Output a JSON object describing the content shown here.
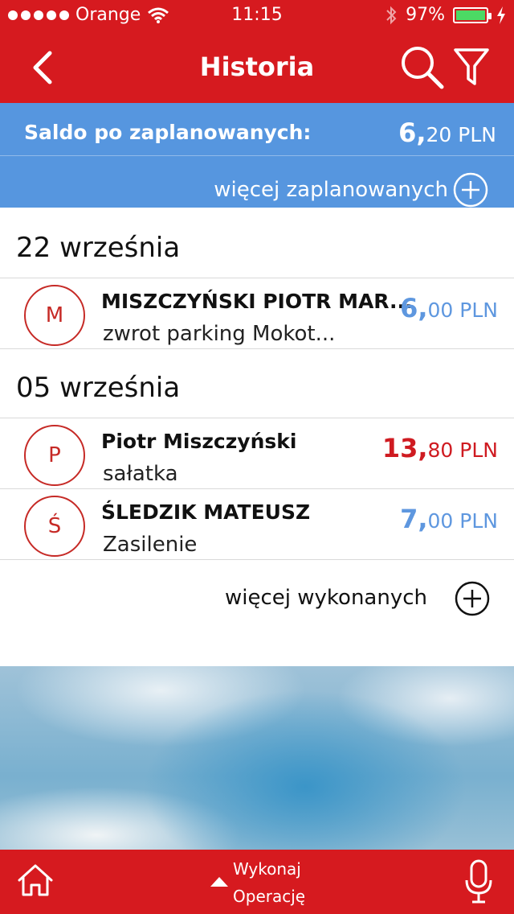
{
  "status_bar": {
    "carrier": "Orange",
    "time": "11:15",
    "battery_percent": "97%",
    "battery_level": 0.97,
    "icons": [
      "signal-dots",
      "wifi-icon",
      "bluetooth-icon",
      "battery-icon",
      "charging-icon"
    ]
  },
  "nav": {
    "title": "Historia",
    "icons": [
      "back-chevron-icon",
      "search-icon",
      "filter-icon"
    ]
  },
  "saldo": {
    "label": "Saldo po zaplanowanych:",
    "amount_int": "6,",
    "amount_dec": "20 PLN",
    "more_planned": "więcej zaplanowanych"
  },
  "groups": [
    {
      "date": "22 września",
      "transactions": [
        {
          "initial": "M",
          "name": "MISZCZYŃSKI PIOTR MAR...",
          "desc": "zwrot parking Mokot...",
          "amount_int": "6,",
          "amount_dec": "00 PLN",
          "color": "#5e97df"
        }
      ]
    },
    {
      "date": "05 września",
      "transactions": [
        {
          "initial": "P",
          "name": "Piotr Miszczyński",
          "desc": "sałatka",
          "amount_int": "13,",
          "amount_dec": "80 PLN",
          "color": "#cf1b21"
        },
        {
          "initial": "Ś",
          "name": "ŚLEDZIK MATEUSZ",
          "desc": "Zasilenie",
          "amount_int": "7,",
          "amount_dec": "00 PLN",
          "color": "#5e97df"
        }
      ]
    }
  ],
  "more_executed": "więcej wykonanych",
  "bottom_bar": {
    "operation_line1": "Wykonaj",
    "operation_line2": "Operację",
    "icons": [
      "home-icon",
      "up-arrow-icon",
      "microphone-icon"
    ]
  },
  "colors": {
    "brand_red": "#d61a1f",
    "balance_blue": "#5696df",
    "amount_blue": "#5e97df",
    "amount_red": "#cf1b21"
  }
}
